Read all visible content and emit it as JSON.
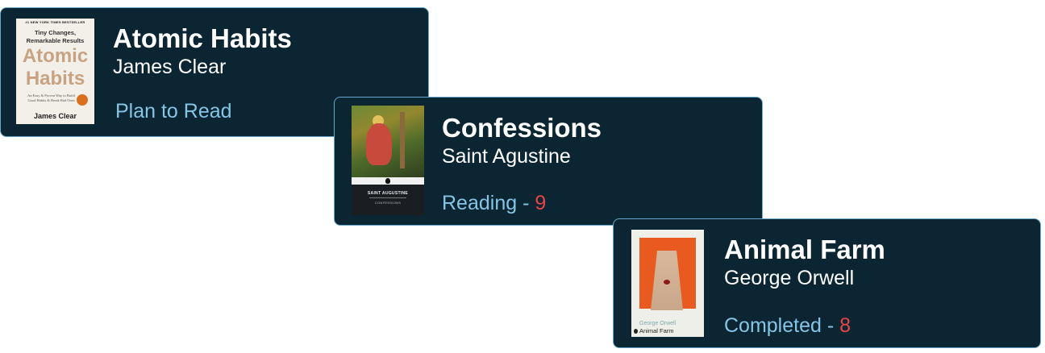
{
  "books": [
    {
      "title": "Atomic Habits",
      "author": "James Clear",
      "status": "Plan to Read",
      "rating": null,
      "cover": {
        "kicker": "#1 NEW YORK TIMES BESTSELLER",
        "subtitle_1": "Tiny Changes,",
        "subtitle_2": "Remarkable Results",
        "title_1": "Atomic",
        "title_2": "Habits",
        "blurb": "An Easy & Proven Way to Build Good Habits & Break Bad Ones",
        "author": "James Clear"
      }
    },
    {
      "title": "Confessions",
      "author": "Saint Agustine",
      "status": "Reading",
      "separator": " - ",
      "rating": "9",
      "cover": {
        "author": "SAINT AUGUSTINE",
        "title": "CONFESSIONS"
      }
    },
    {
      "title": "Animal Farm",
      "author": "George Orwell",
      "status": "Completed",
      "separator": " - ",
      "rating": "8",
      "cover": {
        "author": "George Orwell",
        "title": "Animal Farm"
      }
    }
  ],
  "colors": {
    "card_bg": "#0b2532",
    "card_border": "#6aa8c9",
    "status_text": "#86c5e6",
    "rating_text": "#e84545",
    "title_text": "#ffffff"
  }
}
